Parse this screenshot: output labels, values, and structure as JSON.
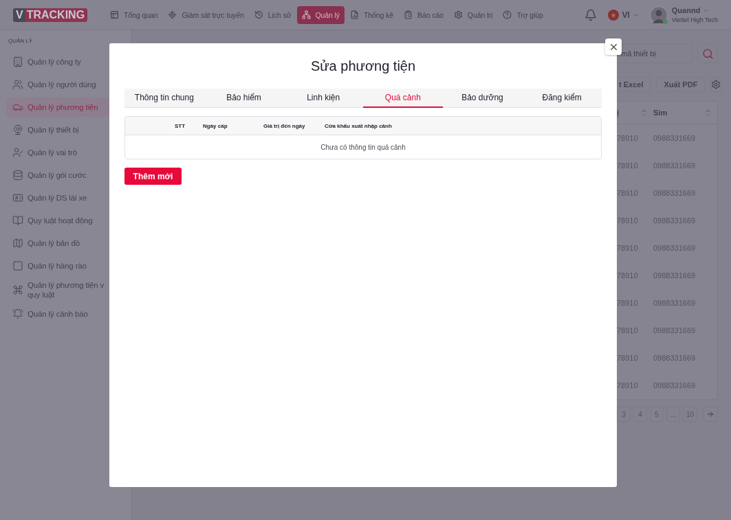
{
  "header": {
    "logo": {
      "prefix": "V",
      "text": "TRACKING"
    },
    "nav": [
      {
        "label": "Tổng quan",
        "selected": false
      },
      {
        "label": "Giám sát trực tuyến",
        "selected": false
      },
      {
        "label": "Lịch sử",
        "selected": false
      },
      {
        "label": "Quản lý",
        "selected": true
      },
      {
        "label": "Thống kê",
        "selected": false
      },
      {
        "label": "Báo cáo",
        "selected": false
      },
      {
        "label": "Quản trị",
        "selected": false
      },
      {
        "label": "Trợ giúp",
        "selected": false
      }
    ],
    "language": "VI",
    "user": {
      "name": "Quannd",
      "org": "Viettel High Tech"
    }
  },
  "sidebar": {
    "section": "QUẢN LÝ",
    "items": [
      {
        "lines": [
          "Quản lý công ty"
        ],
        "selected": false
      },
      {
        "lines": [
          "Quản lý người dùng"
        ],
        "selected": false
      },
      {
        "lines": [
          "Quản lý phương tiện"
        ],
        "selected": true
      },
      {
        "lines": [
          "Quản lý thiết bị"
        ],
        "selected": false
      },
      {
        "lines": [
          "Quản lý vai trò"
        ],
        "selected": false
      },
      {
        "lines": [
          "Quản lý gói cước"
        ],
        "selected": false
      },
      {
        "lines": [
          "Quản lý DS lái xe"
        ],
        "selected": false
      },
      {
        "lines": [
          "Quy luật hoạt động"
        ],
        "selected": false
      },
      {
        "lines": [
          "Quản lý bản đồ"
        ],
        "selected": false
      },
      {
        "lines": [
          "Quản lý hàng rào"
        ],
        "selected": false
      },
      {
        "lines": [
          "Quản lý phương tiện v",
          "quy luật"
        ],
        "selected": false
      },
      {
        "lines": [
          "Quản lý cảnh báo"
        ],
        "selected": false
      }
    ]
  },
  "background": {
    "search_placeholder": "mã thiết bị",
    "buttons": [
      "t Excel",
      "Xuất PDF"
    ],
    "table": {
      "columns": [
        "ị",
        "Sim"
      ],
      "rows": [
        {
          "column_1": "78910",
          "sim": "0988331669"
        },
        {
          "column_1": "78910",
          "sim": "0988331669"
        },
        {
          "column_1": "78910",
          "sim": "0988331669"
        },
        {
          "column_1": "78910",
          "sim": "0988331669"
        },
        {
          "column_1": "78910",
          "sim": "0988331669"
        },
        {
          "column_1": "78910",
          "sim": "0988331669"
        },
        {
          "column_1": "78910",
          "sim": "0988331669"
        },
        {
          "column_1": "78910",
          "sim": "0988331669"
        },
        {
          "column_1": "78910",
          "sim": "0988331669"
        },
        {
          "column_1": "78910",
          "sim": "0988331669"
        }
      ]
    },
    "pagination": [
      "3",
      "4",
      "5",
      "...",
      "10"
    ]
  },
  "modal": {
    "title": "Sửa phương tiện",
    "tabs": [
      {
        "label": "Thông tin chung",
        "selected": false
      },
      {
        "label": "Bảo hiểm",
        "selected": false
      },
      {
        "label": "Linh kiện",
        "selected": false
      },
      {
        "label": "Quá cảnh",
        "selected": true
      },
      {
        "label": "Bảo dưỡng",
        "selected": false
      },
      {
        "label": "Đăng kiểm",
        "selected": false
      }
    ],
    "table": {
      "columns": [
        "STT",
        "Ngày cấp",
        "Giá trị đến ngày",
        "Cửa khẩu xuất nhập cảnh"
      ],
      "empty_text": "Chưa có thông tin quá cảnh"
    },
    "add_button": "Thêm mới"
  }
}
